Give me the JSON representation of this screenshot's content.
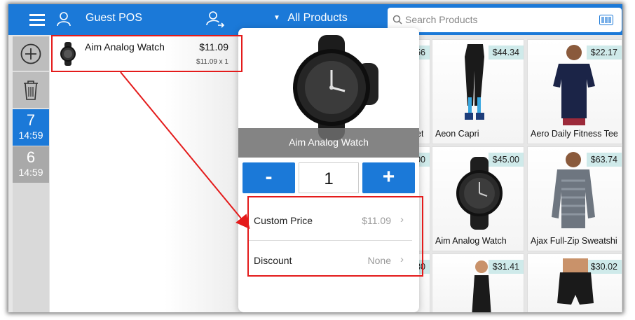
{
  "header": {
    "title": "Guest POS",
    "category_filter": "All Products",
    "search_placeholder": "Search Products"
  },
  "rail": {
    "orders": [
      {
        "number": "7",
        "time": "14:59"
      },
      {
        "number": "6",
        "time": "14:59"
      }
    ]
  },
  "cart": {
    "item_name": "Aim Analog Watch",
    "item_price": "$11.09",
    "item_detail": "$11.09 x 1"
  },
  "popover": {
    "product_name": "Aim Analog Watch",
    "decrement_label": "-",
    "quantity": "1",
    "increment_label": "+",
    "custom_price_label": "Custom Price",
    "custom_price_value": "$11.09",
    "discount_label": "Discount",
    "discount_value": "None"
  },
  "products": [
    {
      "name": "",
      "price": "56"
    },
    {
      "name": "Aeon Capri",
      "price": "$44.34"
    },
    {
      "name": "Aero Daily Fitness Tee",
      "price": "$22.17"
    },
    {
      "name": "",
      "price": "00"
    },
    {
      "name": "Aim Analog Watch",
      "price": "$45.00"
    },
    {
      "name": "Ajax Full-Zip Sweatshirt",
      "price": "$63.74"
    },
    {
      "name": "",
      "price": "30"
    },
    {
      "name": "",
      "price": "$31.41"
    },
    {
      "name": "",
      "price": "$30.02"
    }
  ],
  "partial_labels": {
    "a1": "A",
    "et": "et",
    "a2": "A"
  },
  "colors": {
    "brand": "#1b79d8",
    "annotation": "#e41b1b",
    "price_badge": "#cfeaea"
  }
}
